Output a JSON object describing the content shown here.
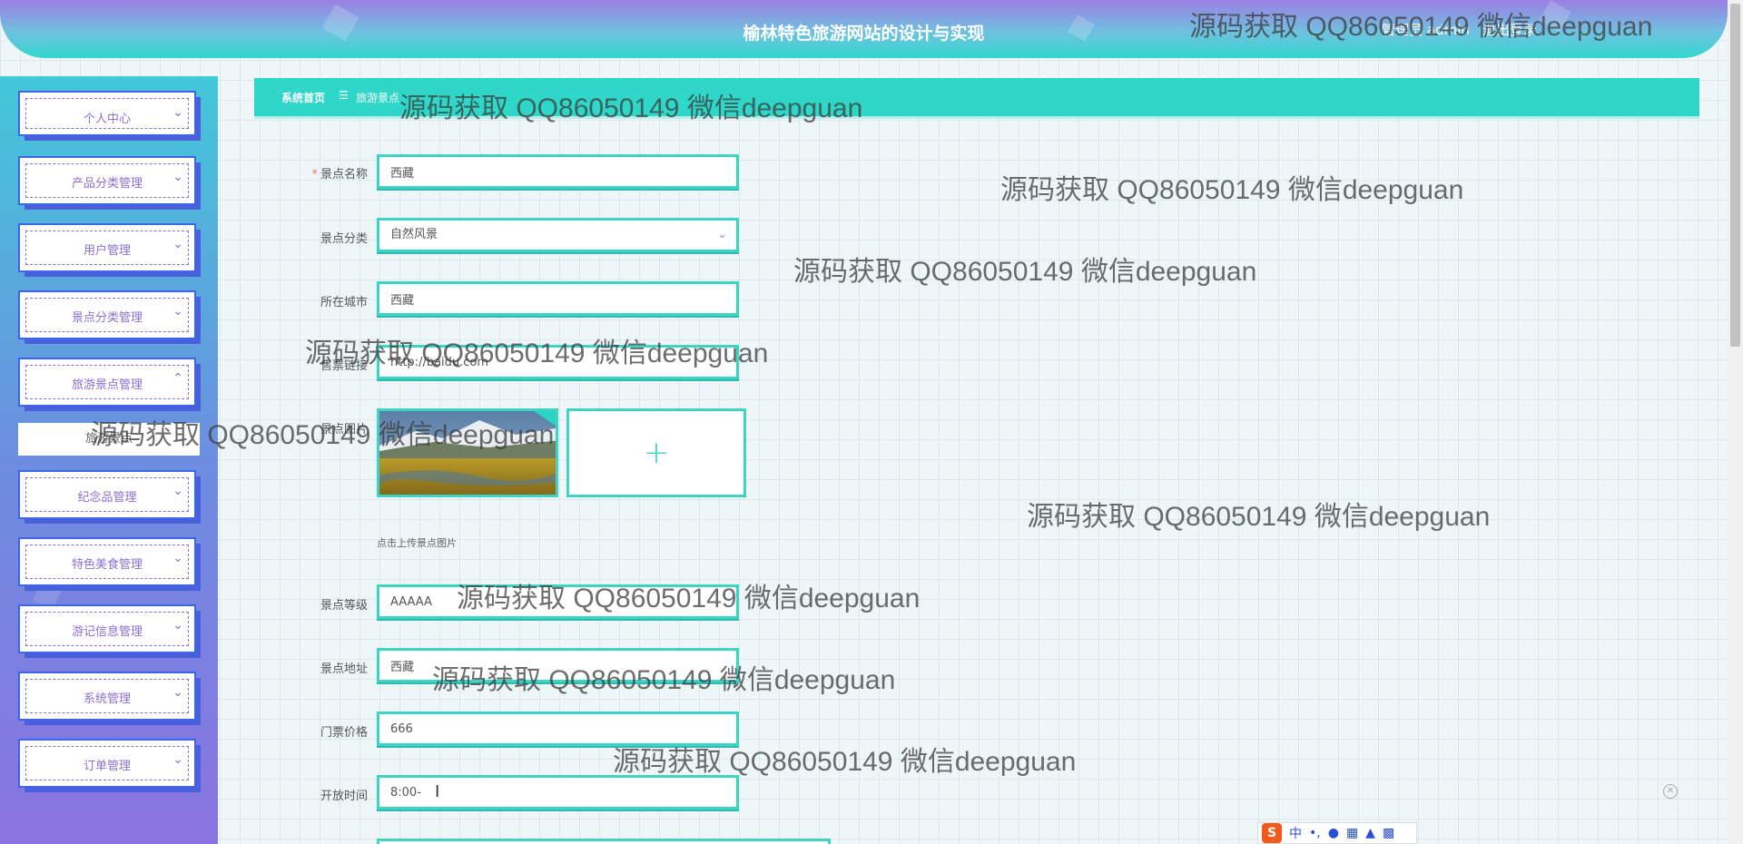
{
  "header": {
    "title": "榆林特色旅游网站的设计与实现",
    "user_label": "管理员 admin",
    "logout_label": "退出登录"
  },
  "sidebar": {
    "items": [
      {
        "label": "个人中心"
      },
      {
        "label": "产品分类管理"
      },
      {
        "label": "用户管理"
      },
      {
        "label": "景点分类管理"
      },
      {
        "label": "旅游景点管理"
      },
      {
        "label": "纪念品管理"
      },
      {
        "label": "特色美食管理"
      },
      {
        "label": "游记信息管理"
      },
      {
        "label": "系统管理"
      },
      {
        "label": "订单管理"
      }
    ],
    "submenu_label": "旅游景点"
  },
  "breadcrumb": {
    "home": "系统首页",
    "separator": "☰",
    "current": "旅游景点"
  },
  "form": {
    "name_label": "景点名称",
    "name_value": "西藏",
    "category_label": "景点分类",
    "category_value": "自然风景",
    "city_label": "所在城市",
    "city_value": "西藏",
    "ticket_link_label": "售票链接",
    "ticket_link_value": "http://baidu.com",
    "image_label": "景点图片",
    "upload_hint": "点击上传景点图片",
    "level_label": "景点等级",
    "level_value": "AAAAA",
    "address_label": "景点地址",
    "address_value": "西藏",
    "price_label": "门票价格",
    "price_value": "666",
    "open_time_label": "开放时间",
    "open_time_value": "8:00-"
  },
  "watermark": "源码获取 QQ86050149 微信deepguan",
  "ime": {
    "s": "S",
    "lang": "中"
  },
  "colors": {
    "accent": "#2fd7c8",
    "sidebar_border": "#3b66e8",
    "menu_text": "#8a6fd6"
  }
}
